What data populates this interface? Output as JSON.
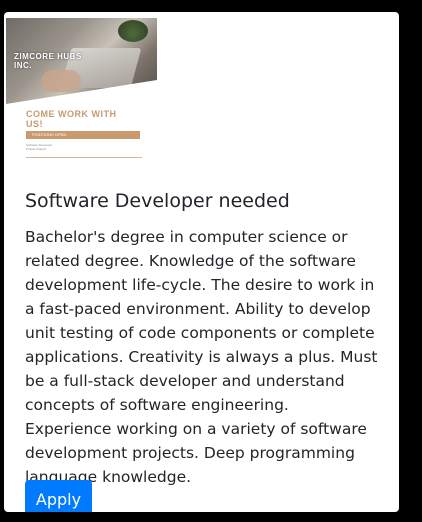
{
  "job": {
    "poster": {
      "brand": "ZIMCORE HUBS INC.",
      "heading": "COME WORK WITH US!",
      "banner": "POSITIONS OPEN",
      "details": "Software Developer\nProject Analyst",
      "footer": ""
    },
    "title": "Software Developer needed",
    "description": "Bachelor's degree in computer science or related degree. Knowledge of the software development life-cycle. The desire to work in a fast-paced environment. Ability to develop unit testing of code components or complete applications. Creativity is always a plus. Must be a full-stack developer and understand concepts of software engineering. Experience working on a variety of software development projects. Deep programming language knowledge.",
    "apply_label": "Apply"
  },
  "colors": {
    "background": "#000000",
    "card": "#ffffff",
    "primary_button": "#007bff",
    "poster_accent": "#c89a6e"
  }
}
